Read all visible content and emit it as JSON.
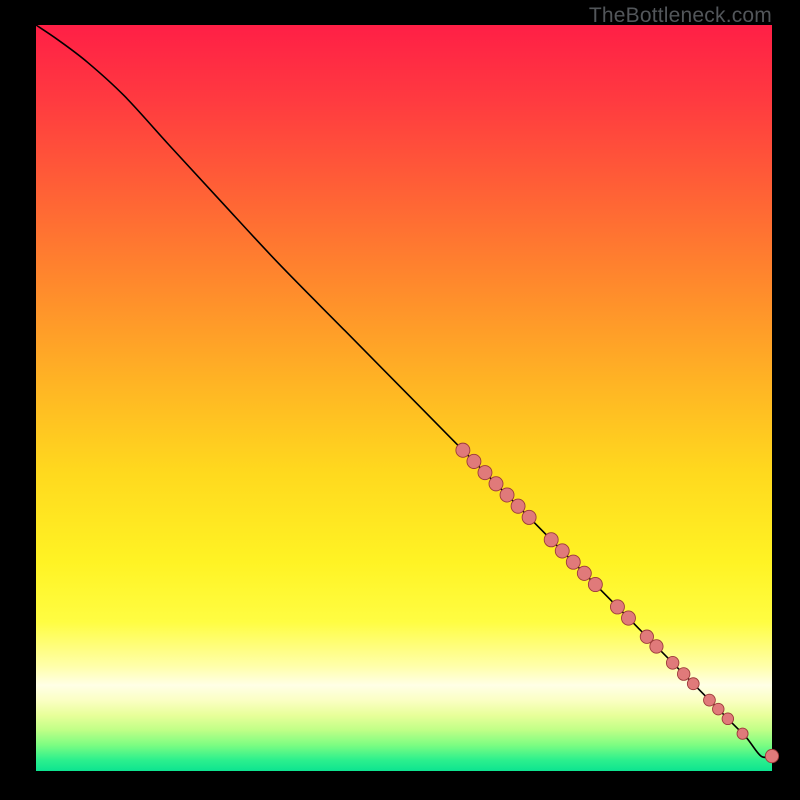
{
  "attribution": "TheBottleneck.com",
  "colors": {
    "marker_fill": "#e07a7a",
    "marker_stroke": "#9c3a3a",
    "curve": "#000000"
  },
  "chart_data": {
    "type": "line",
    "title": "",
    "xlabel": "",
    "ylabel": "",
    "xlim": [
      0,
      100
    ],
    "ylim": [
      0,
      100
    ],
    "series": [
      {
        "name": "curve",
        "x": [
          0,
          3,
          7,
          12,
          18,
          25,
          33,
          42,
          52,
          62,
          72,
          82,
          90,
          94,
          96.5,
          98.5,
          100
        ],
        "y": [
          100,
          98,
          95,
          90.5,
          84,
          76.5,
          68,
          59,
          49,
          39,
          29,
          19,
          11,
          7,
          4.5,
          2,
          2
        ]
      }
    ],
    "markers": [
      {
        "x": 58.0,
        "y": 43.0,
        "r": 0.95
      },
      {
        "x": 59.5,
        "y": 41.5,
        "r": 0.95
      },
      {
        "x": 61.0,
        "y": 40.0,
        "r": 0.95
      },
      {
        "x": 62.5,
        "y": 38.5,
        "r": 0.95
      },
      {
        "x": 64.0,
        "y": 37.0,
        "r": 0.95
      },
      {
        "x": 65.5,
        "y": 35.5,
        "r": 0.95
      },
      {
        "x": 67.0,
        "y": 34.0,
        "r": 0.95
      },
      {
        "x": 70.0,
        "y": 31.0,
        "r": 0.95
      },
      {
        "x": 71.5,
        "y": 29.5,
        "r": 0.95
      },
      {
        "x": 73.0,
        "y": 28.0,
        "r": 0.95
      },
      {
        "x": 74.5,
        "y": 26.5,
        "r": 0.95
      },
      {
        "x": 76.0,
        "y": 25.0,
        "r": 0.95
      },
      {
        "x": 79.0,
        "y": 22.0,
        "r": 0.95
      },
      {
        "x": 80.5,
        "y": 20.5,
        "r": 0.95
      },
      {
        "x": 83.0,
        "y": 18.0,
        "r": 0.9
      },
      {
        "x": 84.3,
        "y": 16.7,
        "r": 0.9
      },
      {
        "x": 86.5,
        "y": 14.5,
        "r": 0.85
      },
      {
        "x": 88.0,
        "y": 13.0,
        "r": 0.85
      },
      {
        "x": 89.3,
        "y": 11.7,
        "r": 0.8
      },
      {
        "x": 91.5,
        "y": 9.5,
        "r": 0.8
      },
      {
        "x": 92.7,
        "y": 8.3,
        "r": 0.78
      },
      {
        "x": 94.0,
        "y": 7.0,
        "r": 0.78
      },
      {
        "x": 96.0,
        "y": 5.0,
        "r": 0.75
      },
      {
        "x": 100.0,
        "y": 2.0,
        "r": 0.9
      }
    ]
  }
}
